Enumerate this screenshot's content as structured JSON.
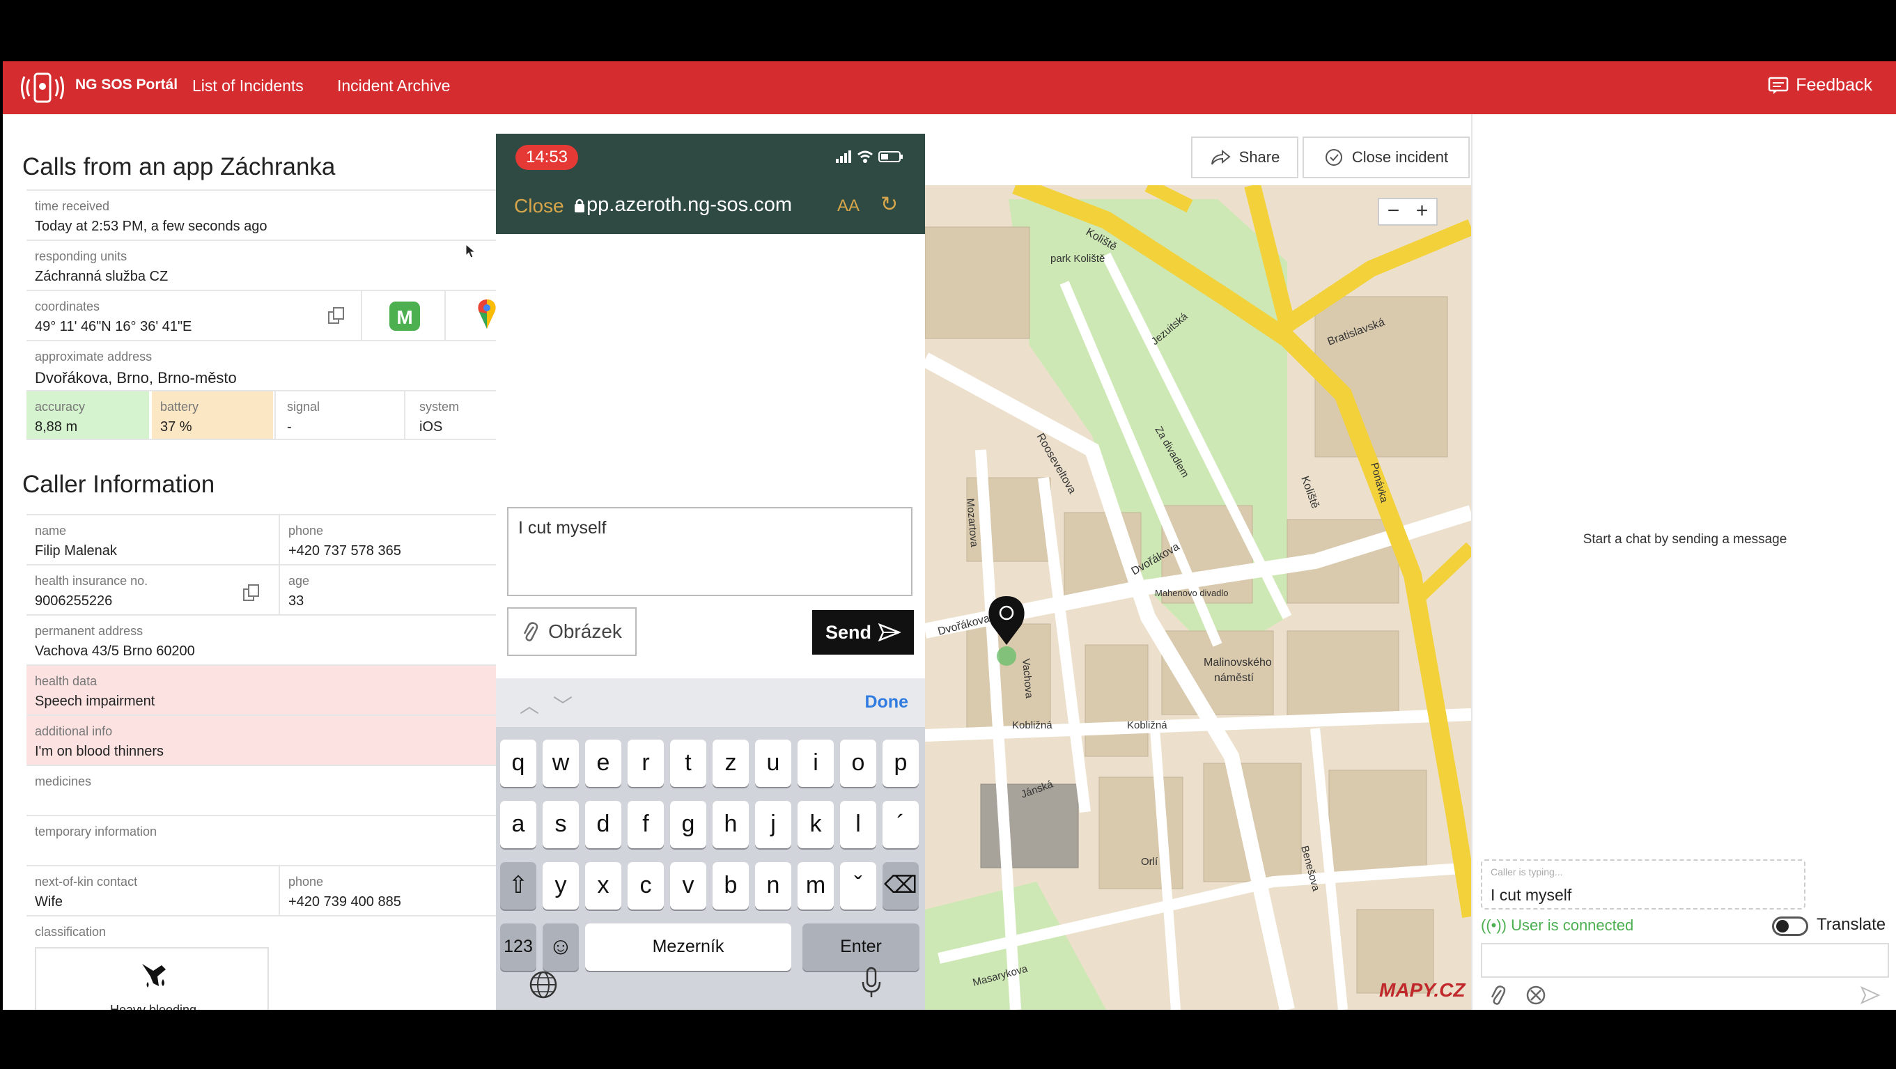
{
  "header": {
    "brand": "NG SOS Portál",
    "nav": [
      "List of Incidents",
      "Incident Archive"
    ],
    "feedback": "Feedback",
    "colors": {
      "brand_red": "#d42c2f"
    }
  },
  "incident": {
    "title": "Calls from an app Záchranka",
    "time_received_label": "time received",
    "time_received": "Today at 2:53 PM, a few seconds ago",
    "units_label": "responding units",
    "units": "Záchranná služba CZ",
    "coords_label": "coordinates",
    "coords": "49° 11' 46\"N 16° 36' 41\"E",
    "address_label": "approximate address",
    "address": "Dvořákova, Brno, Brno-město",
    "accuracy_label": "accuracy",
    "accuracy": "8,88 m",
    "battery_label": "battery",
    "battery": "37  %",
    "signal_label": "signal",
    "signal": "-",
    "system_label": "system",
    "system": "iOS"
  },
  "caller": {
    "title": "Caller Information",
    "name_label": "name",
    "name": "Filip Malenak",
    "phone_label": "phone",
    "phone": "+420 737 578 365",
    "insurance_label": "health insurance no.",
    "insurance": "9006255226",
    "age_label": "age",
    "age": "33",
    "perm_address_label": "permanent address",
    "perm_address": "Vachova 43/5 Brno 60200",
    "health_label": "health data",
    "health": "Speech impairment",
    "info_label": "additional info",
    "info": "I'm on blood thinners",
    "medicines_label": "medicines",
    "temp_label": "temporary information",
    "kin_label": "next-of-kin contact",
    "kin": "Wife",
    "kin_phone_label": "phone",
    "kin_phone": "+420 739 400 885",
    "class_label": "classification",
    "class_value": "Heavy bleeding"
  },
  "phone": {
    "time": "14:53",
    "close": "Close",
    "url": "pp.azeroth.ng-sos.com",
    "aa": "AA",
    "message": "I cut myself",
    "attach": "Obrázek",
    "send": "Send",
    "done": "Done",
    "keys_row1": [
      "q",
      "w",
      "e",
      "r",
      "t",
      "z",
      "u",
      "i",
      "o",
      "p"
    ],
    "keys_row2": [
      "a",
      "s",
      "d",
      "f",
      "g",
      "h",
      "j",
      "k",
      "l",
      "´"
    ],
    "keys_row3": [
      "y",
      "x",
      "c",
      "v",
      "b",
      "n",
      "m",
      "ˇ"
    ],
    "num_key": "123",
    "space_key": "Mezerník",
    "enter_key": "Enter"
  },
  "map": {
    "share": "Share",
    "close_incident": "Close incident",
    "zoom_out": "−",
    "zoom_in": "+",
    "logo": "MAPY.CZ",
    "labels": {
      "kolisti": "Koliště",
      "bratislavska": "Bratislavská",
      "park": "park Koliště",
      "dvorakova": "Dvořákova",
      "roosevelt": "Rooseveltova",
      "malinovskeho": "Malinovského náměstí",
      "kobilizna": "Kobližná",
      "jezuitska": "Jezuitská",
      "za_divadlem": "Za divadlem",
      "vachova": "Vachova",
      "janska": "Jánská",
      "mozartova": "Mozartova",
      "ponavka": "Ponávka",
      "benesova": "Benešova",
      "divadlo": "Mahenovo divadlo",
      "orli": "Orlí",
      "masarykova": "Masarykova"
    }
  },
  "chat": {
    "empty": "Start a chat by sending a message",
    "typing_label": "Caller is typing...",
    "typing_text": "I cut myself",
    "connected": "User is connected",
    "translate": "Translate"
  }
}
